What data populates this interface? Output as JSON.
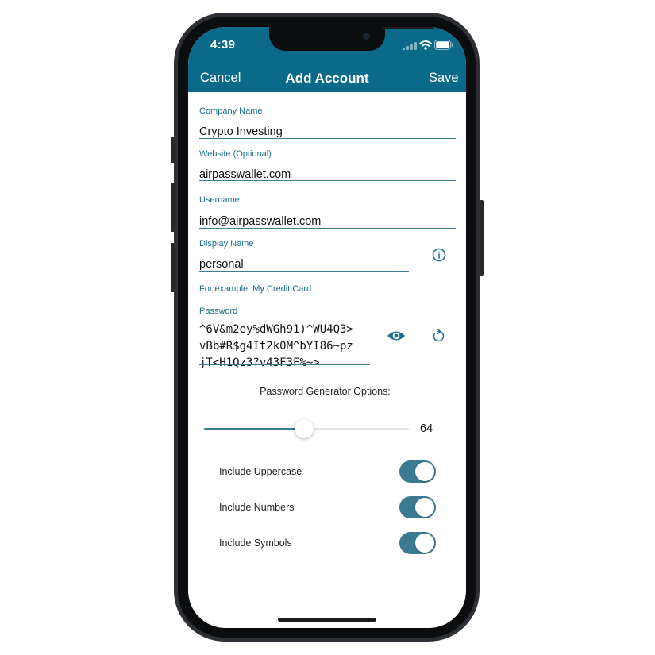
{
  "status_bar": {
    "time": "4:39"
  },
  "nav": {
    "cancel_label": "Cancel",
    "title": "Add Account",
    "save_label": "Save"
  },
  "form": {
    "company_name": {
      "label": "Company Name",
      "value": "Crypto Investing"
    },
    "website": {
      "label": "Website (Optional)",
      "value": "airpasswallet.com"
    },
    "username": {
      "label": "Username",
      "value": "info@airpasswallet.com"
    },
    "display_name": {
      "label": "Display Name",
      "value": "personal",
      "hint": "For example: My Credit Card"
    },
    "password": {
      "label": "Password",
      "value": "^6V&m2ey%dWGh91)^WU4Q3>\nvBb#R$g4It2k0M^bYI86~pz\njT<H1Qz3?v43F3F%~>"
    }
  },
  "generator": {
    "title": "Password Generator Options:",
    "length": 64,
    "length_fraction": 0.49,
    "options": [
      {
        "label": "Include Uppercase",
        "on": true
      },
      {
        "label": "Include Numbers",
        "on": true
      },
      {
        "label": "Include Symbols",
        "on": true
      }
    ]
  },
  "colors": {
    "accent": "#0b6a8a",
    "toggle_on": "#3b7a91",
    "label": "#1d6f8e"
  },
  "icons": {
    "info": "info-icon",
    "reveal": "eye-icon",
    "regenerate": "refresh-icon",
    "signal": "cellular-icon",
    "wifi": "wifi-icon",
    "battery": "battery-icon"
  }
}
